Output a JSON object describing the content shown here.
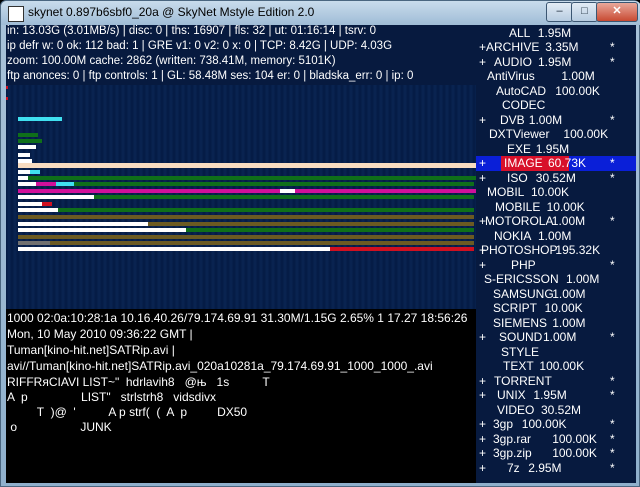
{
  "window": {
    "title": "skynet 0.897b6sbf0_20a @ SkyNet Mstyle Edition 2.0",
    "min_label": "–",
    "max_label": "□",
    "close_label": "✕"
  },
  "stats": [
    "in: 13.03G (3.01MB/s) | disc: 0 | ths: 16907 | fls: 32 | ut: 01:16:14 | tsrv: 0",
    "ip defr w: 0 ok: 112 bad: 1 | GRE v1: 0 v2: 0 x: 0 | TCP: 8.42G | UDP: 4.03G",
    "zoom: 100.00M cache: 2862 (written: 738.41M, memory: 5101K)",
    "ftp anonces: 0 | ftp controls: 1 | GL: 58.48M ses: 104 er: 0 | bladska_err: 0 | ip: 0"
  ],
  "info": [
    "1000 02:0a:10:28:1a 10.16.40.26/79.174.69.91 31.30M/1.15G 2.65% 1 17.27 18:56:26",
    "Mon, 10 May 2010 09:36:22 GMT |",
    "Tuman[kino-hit.net]SATRip.avi |",
    "avi//Tuman[kino-hit.net]SATRip.avi_020a10281a_79.174.69.91_1000_1000_.avi"
  ],
  "payload": [
    "RIFFRяCIAVI LIST~\"  hdrlavih8   @њ   1s          T",
    "A  p                LIST\"   strlstrh8   vidsdivx",
    "         T  )@  '          A p strf(  (  A  p         DX50",
    " o                   JUNK"
  ],
  "categories": [
    {
      "prefix": "",
      "label": "ALL",
      "value": "1.95M",
      "star": "",
      "selected": false
    },
    {
      "prefix": "+",
      "label": "ARCHIVE",
      "value": "3.35M",
      "star": "*",
      "selected": false
    },
    {
      "prefix": "+",
      "label": "AUDIO",
      "value": "1.95M",
      "star": "*",
      "selected": false
    },
    {
      "prefix": "",
      "label": "AntiVirus",
      "value": "1.00M",
      "star": "",
      "selected": false
    },
    {
      "prefix": "",
      "label": "AutoCAD",
      "value": "100.00K",
      "star": "",
      "selected": false
    },
    {
      "prefix": "",
      "label": "CODEC",
      "value": "",
      "star": "",
      "selected": false
    },
    {
      "prefix": "+",
      "label": "DVB",
      "value": "1.00M",
      "star": "*",
      "selected": false
    },
    {
      "prefix": "",
      "label": "DXTViewer",
      "value": "100.00K",
      "star": "",
      "selected": false
    },
    {
      "prefix": "",
      "label": "EXE",
      "value": "1.95M",
      "star": "",
      "selected": false
    },
    {
      "prefix": "+",
      "label": "IMAGE",
      "value": "60.73K",
      "star": "*",
      "selected": true
    },
    {
      "prefix": "+",
      "label": "ISO",
      "value": "30.52M",
      "star": "*",
      "selected": false
    },
    {
      "prefix": "",
      "label": "MOBIL",
      "value": "10.00K",
      "star": "",
      "selected": false
    },
    {
      "prefix": "",
      "label": "MOBILE",
      "value": "10.00K",
      "star": "",
      "selected": false
    },
    {
      "prefix": "+",
      "label": "MOTOROLA",
      "value": "1.00M",
      "star": "*",
      "selected": false
    },
    {
      "prefix": "",
      "label": "NOKIA",
      "value": "1.00M",
      "star": "",
      "selected": false
    },
    {
      "prefix": "+",
      "label": "PHOTOSHOP",
      "value": "195.32K",
      "star": "",
      "selected": false
    },
    {
      "prefix": "+",
      "label": "PHP",
      "value": "",
      "star": "*",
      "selected": false
    },
    {
      "prefix": "",
      "label": "S-ERICSSON",
      "value": "1.00M",
      "star": "",
      "selected": false
    },
    {
      "prefix": "",
      "label": "SAMSUNG",
      "value": "1.00M",
      "star": "",
      "selected": false
    },
    {
      "prefix": "",
      "label": "SCRIPT",
      "value": "10.00K",
      "star": "",
      "selected": false
    },
    {
      "prefix": "",
      "label": "SIEMENS",
      "value": "1.00M",
      "star": "",
      "selected": false
    },
    {
      "prefix": "+",
      "label": "SOUND",
      "value": "1.00M",
      "star": "*",
      "selected": false
    },
    {
      "prefix": "",
      "label": "STYLE",
      "value": "",
      "star": "",
      "selected": false
    },
    {
      "prefix": "",
      "label": "TEXT",
      "value": "100.00K",
      "star": "",
      "selected": false
    },
    {
      "prefix": "+",
      "label": "TORRENT",
      "value": "",
      "star": "*",
      "selected": false
    },
    {
      "prefix": "+",
      "label": "UNIX",
      "value": "1.95M",
      "star": "*",
      "selected": false
    },
    {
      "prefix": "",
      "label": "VIDEO",
      "value": "30.52M",
      "star": "",
      "selected": false
    },
    {
      "prefix": "+",
      "label": "3gp",
      "value": "100.00K",
      "star": "*",
      "selected": false
    },
    {
      "prefix": "+",
      "label": "3gp.rar",
      "value": "100.00K",
      "star": "*",
      "selected": false
    },
    {
      "prefix": "+",
      "label": "3gp.zip",
      "value": "100.00K",
      "star": "*",
      "selected": false
    },
    {
      "prefix": "+",
      "label": "7z",
      "value": "2.95M",
      "star": "*",
      "selected": false
    }
  ],
  "colors": {
    "panel_bg": "#071a3f",
    "selected_bg": "#0a1fd8",
    "selected_label_bg": "#d8102a",
    "bar_white": "#ffffff",
    "bar_green": "#0f6f1a",
    "bar_magenta": "#d0109a",
    "bar_cyan": "#40e0f0",
    "bar_olive": "#6b5a22",
    "bar_red": "#d01020",
    "bar_gray": "#707070",
    "bar_peach": "#f8dcc0"
  }
}
